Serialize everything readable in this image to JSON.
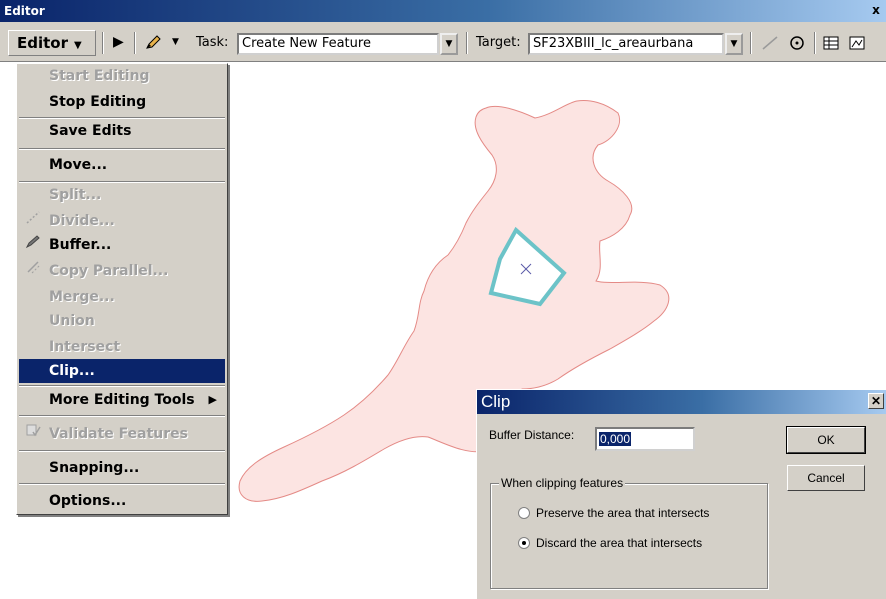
{
  "toolbar": {
    "window_title": "Editor",
    "close_glyph": "x",
    "editor_menu_label": "Editor",
    "task_label": "Task:",
    "task_value": "Create New Feature",
    "target_label": "Target:",
    "target_value": "SF23XBIII_lc_areaurbana"
  },
  "menu": {
    "items": [
      {
        "label": "Start Editing",
        "enabled": false
      },
      {
        "label": "Stop Editing",
        "enabled": true
      },
      {
        "label": "Save Edits",
        "enabled": true
      },
      {
        "label": "Move...",
        "enabled": true
      },
      {
        "label": "Split...",
        "enabled": false
      },
      {
        "label": "Divide...",
        "enabled": false,
        "icon": "divide-icon"
      },
      {
        "label": "Buffer...",
        "enabled": true,
        "icon": "pencil-icon"
      },
      {
        "label": "Copy Parallel...",
        "enabled": false,
        "icon": "copy-parallel-icon"
      },
      {
        "label": "Merge...",
        "enabled": false
      },
      {
        "label": "Union",
        "enabled": false
      },
      {
        "label": "Intersect",
        "enabled": false
      },
      {
        "label": "Clip...",
        "enabled": true,
        "selected": true
      },
      {
        "label": "More Editing Tools",
        "enabled": true,
        "submenu": true
      },
      {
        "label": "Validate Features",
        "enabled": false,
        "icon": "validate-icon"
      },
      {
        "label": "Snapping...",
        "enabled": true
      },
      {
        "label": "Options...",
        "enabled": true
      }
    ]
  },
  "dialog": {
    "title": "Clip",
    "buffer_label": "Buffer Distance:",
    "buffer_value": "0,000",
    "ok_label": "OK",
    "cancel_label": "Cancel",
    "group_label": "When clipping features",
    "options": [
      {
        "label": "Preserve the area that intersects",
        "selected": false
      },
      {
        "label": "Discard the area that intersects",
        "selected": true
      }
    ]
  },
  "colors": {
    "polygon_fill": "#fce4e2",
    "polygon_stroke": "#e48a86",
    "selection_stroke": "#6cc3c8",
    "menu_highlight": "#0a246a"
  }
}
